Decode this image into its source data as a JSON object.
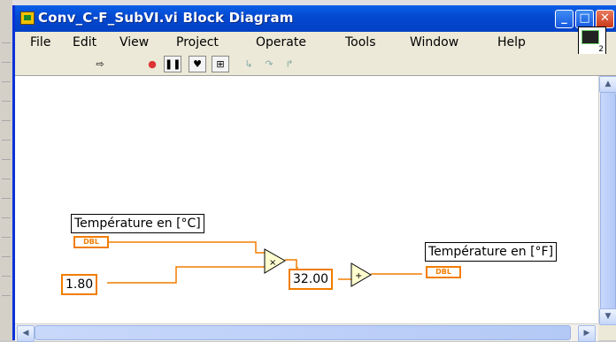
{
  "window": {
    "title": "Conv_C-F_SubVI.vi Block Diagram",
    "buttons": {
      "minimize": "_",
      "maximize": "□",
      "close": "✕"
    }
  },
  "menu": [
    "File",
    "Edit",
    "View",
    "Project",
    "Operate",
    "Tools",
    "Window",
    "Help"
  ],
  "vi_icon": {
    "number": "2"
  },
  "diagram": {
    "input_label": "Température en [°C]",
    "input_type": "DBL",
    "factor": "1.80",
    "offset": "32.00",
    "output_label": "Température en [°F]",
    "output_type": "DBL",
    "multiply_symbol": "×",
    "add_symbol": "+"
  },
  "colors": {
    "wire": "#f17d00",
    "titlebar": "#0348cf"
  }
}
